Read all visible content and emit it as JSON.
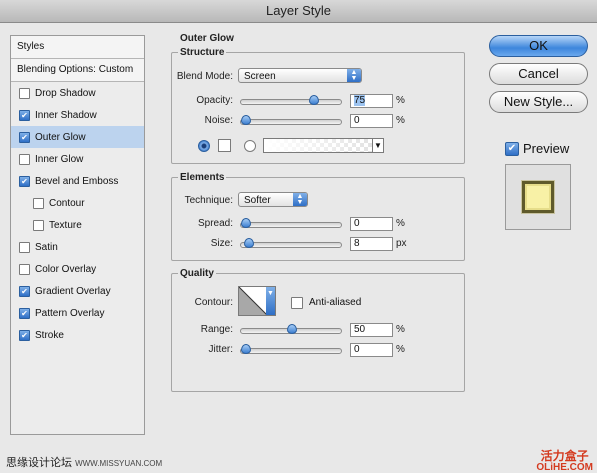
{
  "window": {
    "title": "Layer Style"
  },
  "sidebar": {
    "styles_header": "Styles",
    "blending_options": "Blending Options: Custom",
    "items": [
      {
        "label": "Drop Shadow",
        "checked": false,
        "active": false,
        "sub": false
      },
      {
        "label": "Inner Shadow",
        "checked": true,
        "active": false,
        "sub": false
      },
      {
        "label": "Outer Glow",
        "checked": true,
        "active": true,
        "sub": false
      },
      {
        "label": "Inner Glow",
        "checked": false,
        "active": false,
        "sub": false
      },
      {
        "label": "Bevel and Emboss",
        "checked": true,
        "active": false,
        "sub": false
      },
      {
        "label": "Contour",
        "checked": false,
        "active": false,
        "sub": true
      },
      {
        "label": "Texture",
        "checked": false,
        "active": false,
        "sub": true
      },
      {
        "label": "Satin",
        "checked": false,
        "active": false,
        "sub": false
      },
      {
        "label": "Color Overlay",
        "checked": false,
        "active": false,
        "sub": false
      },
      {
        "label": "Gradient Overlay",
        "checked": true,
        "active": false,
        "sub": false
      },
      {
        "label": "Pattern Overlay",
        "checked": true,
        "active": false,
        "sub": false
      },
      {
        "label": "Stroke",
        "checked": true,
        "active": false,
        "sub": false
      }
    ]
  },
  "panel": {
    "title": "Outer Glow",
    "structure": {
      "title": "Structure",
      "blend_mode_label": "Blend Mode:",
      "blend_mode_value": "Screen",
      "opacity_label": "Opacity:",
      "opacity_value": "75",
      "opacity_level": 75,
      "noise_label": "Noise:",
      "noise_value": "0",
      "noise_level": 0,
      "percent": "%",
      "glow_color": "#ffffff"
    },
    "elements": {
      "title": "Elements",
      "technique_label": "Technique:",
      "technique_value": "Softer",
      "spread_label": "Spread:",
      "spread_value": "0",
      "spread_level": 0,
      "size_label": "Size:",
      "size_value": "8",
      "size_level": 3,
      "percent": "%",
      "px": "px"
    },
    "quality": {
      "title": "Quality",
      "contour_label": "Contour:",
      "anti_aliased_label": "Anti-aliased",
      "anti_aliased": false,
      "range_label": "Range:",
      "range_value": "50",
      "range_level": 50,
      "jitter_label": "Jitter:",
      "jitter_value": "0",
      "jitter_level": 0,
      "percent": "%"
    }
  },
  "buttons": {
    "ok": "OK",
    "cancel": "Cancel",
    "new_style": "New Style...",
    "preview_label": "Preview",
    "preview_checked": true
  },
  "watermark": {
    "left_cn": "思缘设计论坛",
    "left_url": "WWW.MISSYUAN.COM",
    "right_cn": "活力盒子",
    "right_en": "OLiHE.COM"
  },
  "colors": {
    "accent": "#2f6fc6",
    "selected_row": "#bcd3ee",
    "preview_fill": "#f8f1a6"
  }
}
